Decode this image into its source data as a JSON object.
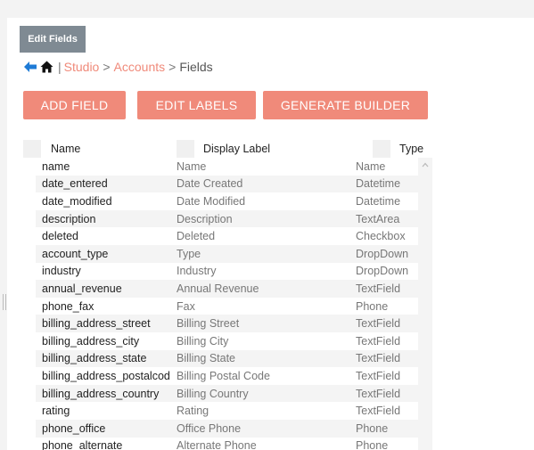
{
  "tab": {
    "label": "Edit Fields"
  },
  "breadcrumb": {
    "back_icon": "back-arrow-icon",
    "home_icon": "home-icon",
    "separator_bar": "|",
    "studio": "Studio",
    "sep1": ">",
    "accounts": "Accounts",
    "sep2": ">",
    "current": "Fields"
  },
  "toolbar": {
    "add_field": "ADD FIELD",
    "edit_labels": "EDIT LABELS",
    "generate_builder": "GENERATE BUILDER"
  },
  "table": {
    "columns": {
      "name": "Name",
      "display_label": "Display Label",
      "type": "Type"
    },
    "rows": [
      {
        "name": "name",
        "label": "Name",
        "type": "Name"
      },
      {
        "name": "date_entered",
        "label": "Date Created",
        "type": "Datetime"
      },
      {
        "name": "date_modified",
        "label": "Date Modified",
        "type": "Datetime"
      },
      {
        "name": "description",
        "label": "Description",
        "type": "TextArea"
      },
      {
        "name": "deleted",
        "label": "Deleted",
        "type": "Checkbox"
      },
      {
        "name": "account_type",
        "label": "Type",
        "type": "DropDown"
      },
      {
        "name": "industry",
        "label": "Industry",
        "type": "DropDown"
      },
      {
        "name": "annual_revenue",
        "label": "Annual Revenue",
        "type": "TextField"
      },
      {
        "name": "phone_fax",
        "label": "Fax",
        "type": "Phone"
      },
      {
        "name": "billing_address_street",
        "label": "Billing Street",
        "type": "TextField"
      },
      {
        "name": "billing_address_city",
        "label": "Billing City",
        "type": "TextField"
      },
      {
        "name": "billing_address_state",
        "label": "Billing State",
        "type": "TextField"
      },
      {
        "name": "billing_address_postalcode",
        "label": "Billing Postal Code",
        "type": "TextField"
      },
      {
        "name": "billing_address_country",
        "label": "Billing Country",
        "type": "TextField"
      },
      {
        "name": "rating",
        "label": "Rating",
        "type": "TextField"
      },
      {
        "name": "phone_office",
        "label": "Office Phone",
        "type": "Phone"
      },
      {
        "name": "phone_alternate",
        "label": "Alternate Phone",
        "type": "Phone"
      }
    ]
  },
  "colors": {
    "accent": "#f08a7a",
    "tab_bg": "#7f8a93",
    "back_icon": "#1e7bd6"
  }
}
